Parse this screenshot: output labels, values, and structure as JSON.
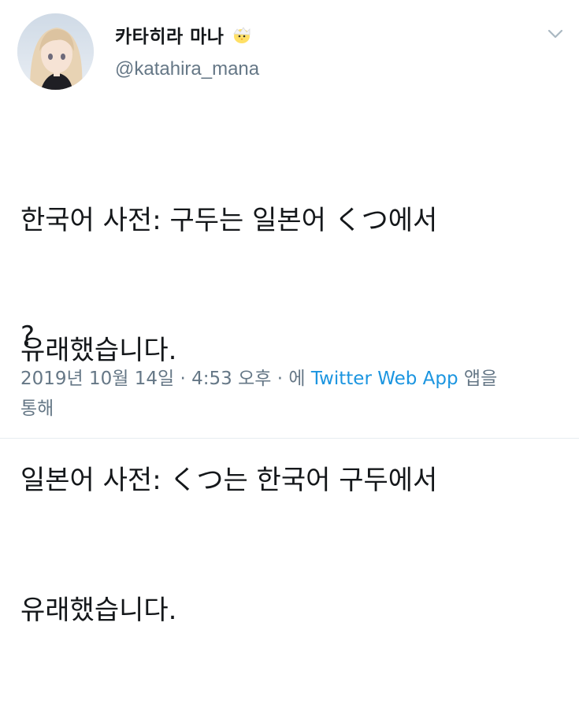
{
  "user": {
    "display_name": "카타히라 마나",
    "handle": "@katahira_mana",
    "name_emoji": "chick-icon"
  },
  "tweet": {
    "lines": [
      "한국어 사전: 구두는 일본어 くつ에서",
      "유래했습니다.",
      "일본어 사전: くつ는 한국어 구두에서",
      "유래했습니다."
    ],
    "question": "?"
  },
  "meta": {
    "date": "2019년 10월 14일",
    "separator": "·",
    "time": "4:53 오후",
    "via_prefix": "에",
    "source": "Twitter Web App",
    "via_suffix_line1": "앱을",
    "via_suffix_line2": "통해"
  },
  "colors": {
    "text": "#14171a",
    "secondary": "#657786",
    "link": "#1b95e0"
  }
}
